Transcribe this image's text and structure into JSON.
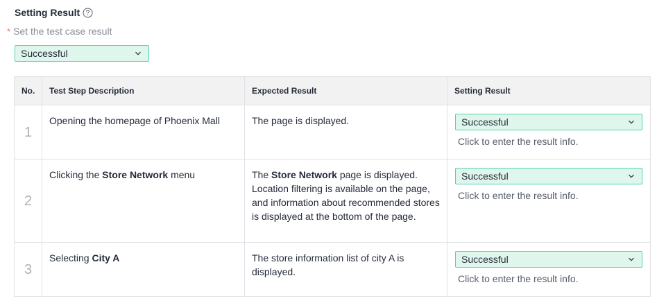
{
  "header": {
    "title": "Setting Result",
    "help_icon": "question-circle-icon"
  },
  "required": {
    "star": "*",
    "label": "Set the test case result"
  },
  "main_select": {
    "value": "Successful"
  },
  "table": {
    "columns": [
      "No.",
      "Test Step Description",
      "Expected Result",
      "Setting Result"
    ],
    "rows": [
      {
        "no": "1",
        "desc_before": "Opening the homepage of Phoenix Mall",
        "desc_bold": "",
        "desc_after": "",
        "exp_before": "The page is displayed.",
        "exp_bold": "",
        "exp_after": "",
        "setting": "Successful",
        "info": "Click to enter the result info."
      },
      {
        "no": "2",
        "desc_before": "Clicking the ",
        "desc_bold": "Store Network",
        "desc_after": " menu",
        "exp_before": "The ",
        "exp_bold": "Store Network",
        "exp_after": " page is displayed. Location filtering is available on the page, and information about recommended stores is displayed at the bottom of the page.",
        "setting": "Successful",
        "info": "Click to enter the result info."
      },
      {
        "no": "3",
        "desc_before": "Selecting ",
        "desc_bold": "City A",
        "desc_after": "",
        "exp_before": "The store information list of city A is displayed.",
        "exp_bold": "",
        "exp_after": "",
        "setting": "Successful",
        "info": "Click to enter the result info."
      }
    ]
  },
  "colors": {
    "select_bg": "#dff6ec",
    "select_border": "#50d4ab",
    "required_star": "#f66f6a",
    "header_bg": "#f2f2f3",
    "border": "#dfe1e6"
  }
}
